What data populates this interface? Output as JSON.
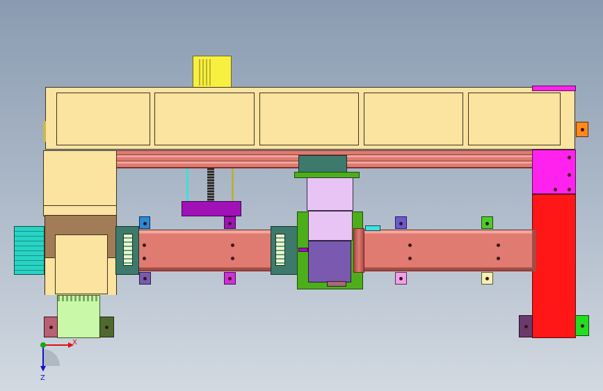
{
  "colors": {
    "background_top": "#8a9bb1",
    "background_bottom": "#d2d9e1",
    "gantry": "#fbe3a0",
    "rail": "#e07b72",
    "column_red": "#ff1616",
    "bracket_magenta": "#ff22ee",
    "carriage_teal": "#3d7a6b",
    "motor_purple": "#7a5ab0",
    "motor_lilac": "#e8c4f5",
    "plate_violet": "#a012b8",
    "plate_green": "#4caf1a",
    "motor_yellow": "#f8f040",
    "motor_cyan": "#27d4c4",
    "motor_lime": "#c8f8a8",
    "brown_housing": "#a27c56"
  },
  "triad": {
    "x_label": "X",
    "z_label": "Z",
    "x_color": "#dd1111",
    "y_color": "#11aa11",
    "z_color": "#1111cc"
  }
}
